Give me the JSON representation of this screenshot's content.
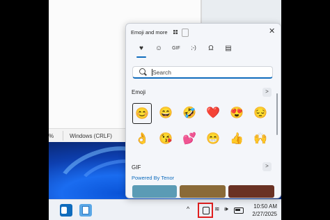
{
  "statusbar": {
    "zoom": "%",
    "encoding": "Windows (CRLF)"
  },
  "panel": {
    "title": "Emoji and more",
    "tabs": [
      {
        "name": "favorites",
        "glyph": "♥"
      },
      {
        "name": "emoji",
        "glyph": "☺"
      },
      {
        "name": "gif",
        "glyph": "GIF"
      },
      {
        "name": "kaomoji",
        "glyph": ";-)"
      },
      {
        "name": "symbols",
        "glyph": "Ω"
      },
      {
        "name": "clipboard",
        "glyph": "▤"
      }
    ],
    "search_placeholder": "Search",
    "emoji_section": "Emoji",
    "emoji_row1": [
      "😊",
      "😄",
      "🤣",
      "❤️",
      "😍",
      "😔"
    ],
    "emoji_row2": [
      "👌",
      "😘",
      "💕",
      "😁",
      "👍",
      "🙌"
    ],
    "gif_section": "GIF",
    "powered_by": "Powered By Tenor",
    "more": ">"
  },
  "taskbar": {
    "time": "10:50 AM",
    "date": "2/27/2025",
    "chevron": "^",
    "wifi": "≋",
    "volume": "🕪"
  },
  "colors": {
    "accent": "#0f6cbd",
    "highlight": "#e01e1e"
  }
}
